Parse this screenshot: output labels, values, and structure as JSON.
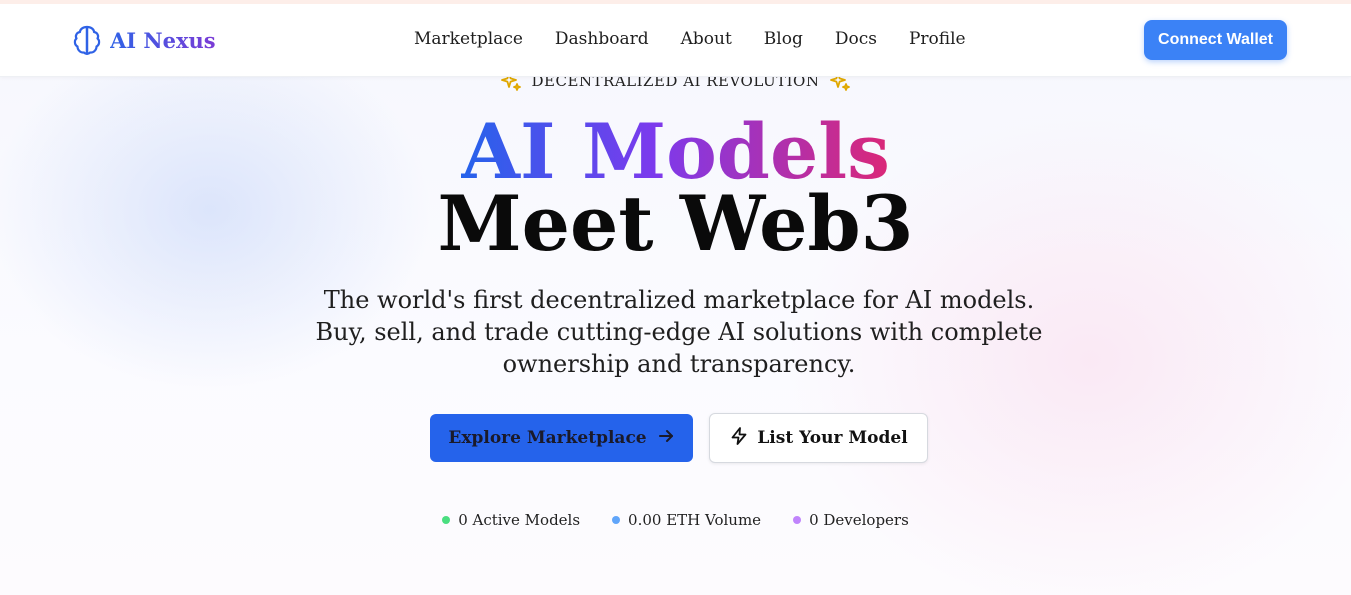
{
  "brand": {
    "name": "AI Nexus",
    "icon": "brain-icon"
  },
  "nav": {
    "items": [
      {
        "label": "Marketplace"
      },
      {
        "label": "Dashboard"
      },
      {
        "label": "About"
      },
      {
        "label": "Blog"
      },
      {
        "label": "Docs"
      },
      {
        "label": "Profile"
      }
    ]
  },
  "header": {
    "connect_label": "Connect Wallet"
  },
  "hero": {
    "eyebrow": "DECENTRALIZED AI REVOLUTION",
    "eyebrow_icon": "sparkles-icon",
    "title_line1": "AI Models",
    "title_line2": "Meet Web3",
    "subtitle": "The world's first decentralized marketplace for AI models. Buy, sell, and trade cutting-edge AI solutions with complete ownership and transparency.",
    "primary_button": "Explore Marketplace",
    "primary_icon": "arrow-right-icon",
    "secondary_button": "List Your Model",
    "secondary_icon": "lightning-icon"
  },
  "stats": [
    {
      "label": "0 Active Models",
      "color": "#4ade80"
    },
    {
      "label": "0.00 ETH Volume",
      "color": "#60a5fa"
    },
    {
      "label": "0 Developers",
      "color": "#c084fc"
    }
  ],
  "colors": {
    "accent": "#2563eb",
    "connect": "#3b82f6",
    "gradient_start": "#2563eb",
    "gradient_mid": "#7c3aed",
    "gradient_end": "#db2777",
    "sparkle": "#eab308"
  }
}
